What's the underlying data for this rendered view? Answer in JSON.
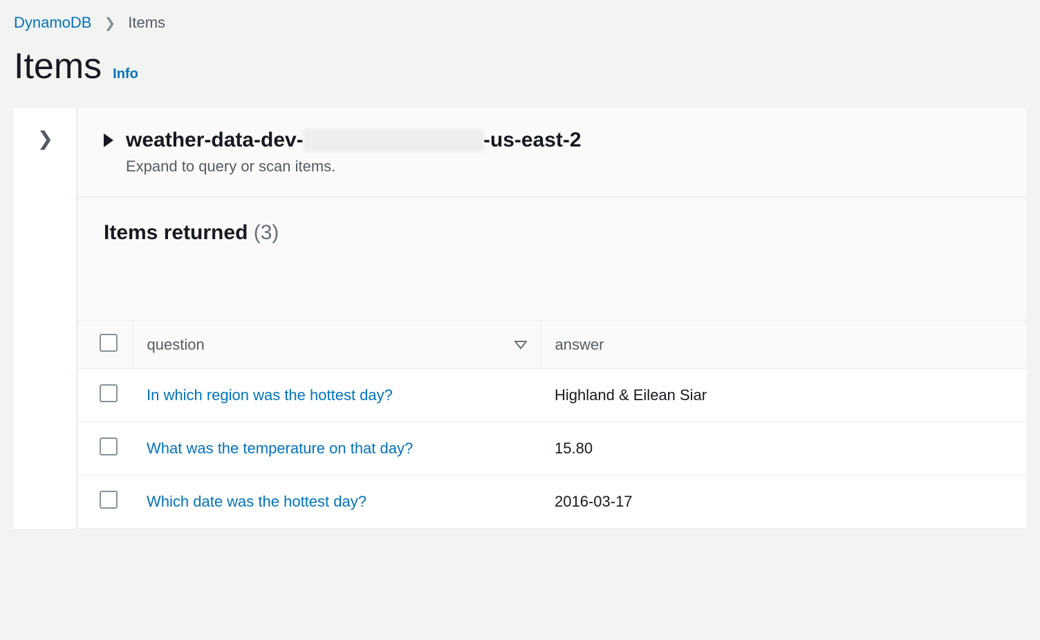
{
  "breadcrumb": {
    "root": "DynamoDB",
    "current": "Items"
  },
  "page": {
    "title": "Items",
    "info_label": "Info"
  },
  "table_block": {
    "name_prefix": "weather-data-dev-",
    "name_redacted": "XXXXXXXXXXXXX",
    "name_suffix": "-us-east-2",
    "expand_hint": "Expand to query or scan items."
  },
  "results": {
    "label": "Items returned",
    "count": "(3)",
    "columns": {
      "question": "question",
      "answer": "answer"
    },
    "rows": [
      {
        "question": "In which region was the hottest day?",
        "answer": "Highland & Eilean Siar"
      },
      {
        "question": "What was the temperature on that day?",
        "answer": "15.80"
      },
      {
        "question": "Which date was the hottest day?",
        "answer": "2016-03-17"
      }
    ]
  }
}
